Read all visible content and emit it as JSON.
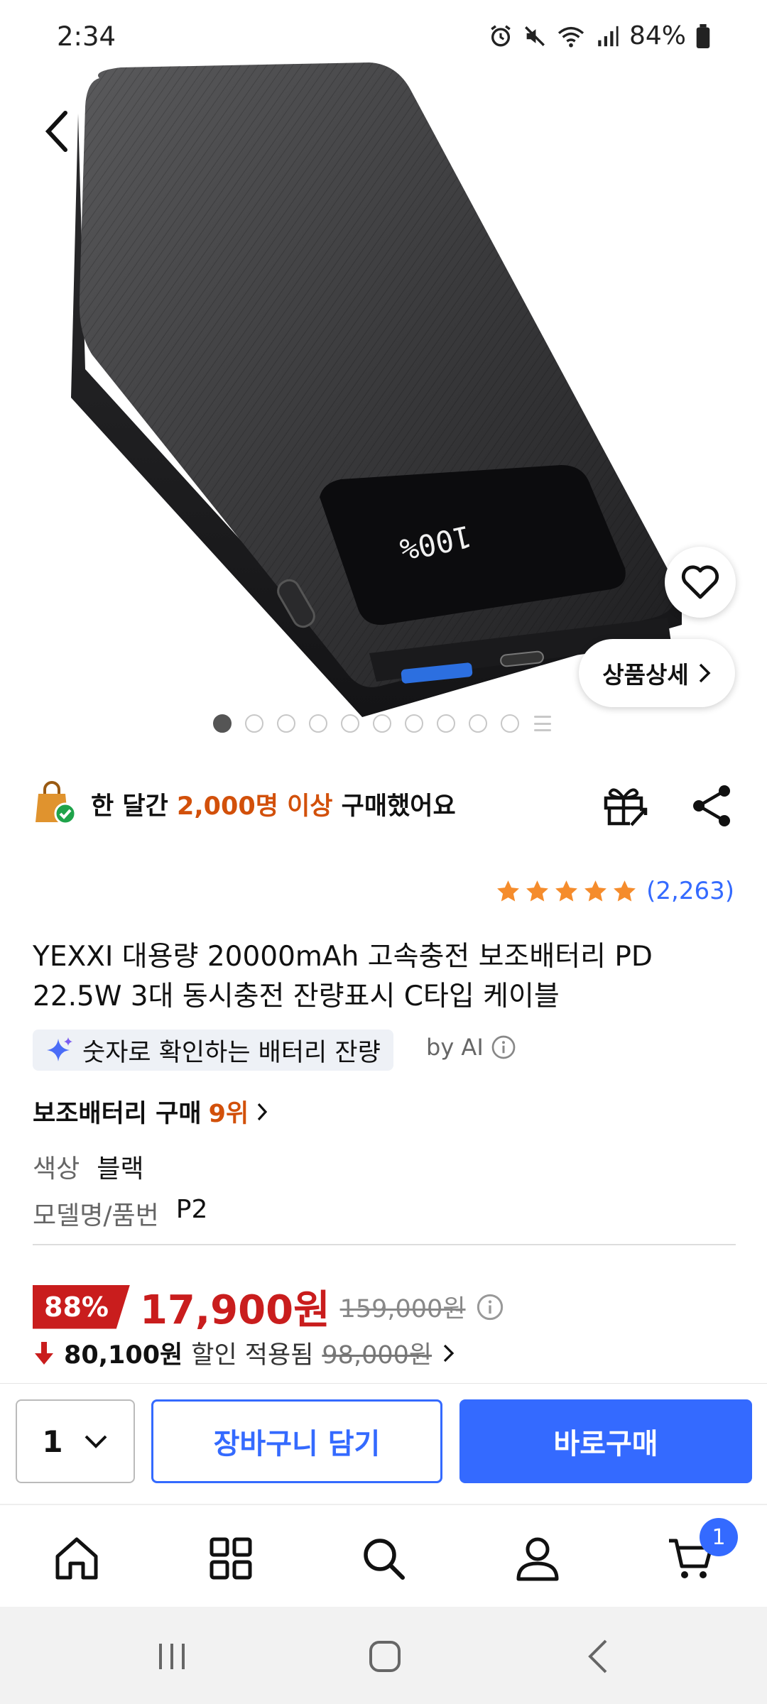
{
  "status_bar": {
    "time": "2:34",
    "battery": "84%"
  },
  "gallery": {
    "total_slides": 10,
    "active_index": 0,
    "detail_label": "상품상세"
  },
  "purchase_banner": {
    "prefix": "한 달간",
    "highlight": "2,000명 이상",
    "suffix": "구매했어요"
  },
  "rating": {
    "stars": 5,
    "count": "(2,263)"
  },
  "product": {
    "title": "YEXXI 대용량 20000mAh 고속충전 보조배터리 PD 22.5W 3대 동시충전 잔량표시 C타입 케이블",
    "ai_highlight": "숫자로 확인하는 배터리 잔량",
    "by_ai": "by AI",
    "rank_label": "보조배터리 구매",
    "rank_value": "9위",
    "specs": [
      {
        "key": "색상",
        "value": "블랙"
      },
      {
        "key": "모델명/품번",
        "value": "P2"
      }
    ]
  },
  "price": {
    "discount_rate": "88%",
    "sale_price": "17,900원",
    "original_price": "159,000원",
    "extra_discount": "80,100원",
    "extra_discount_label": "할인 적용됨",
    "extra_original": "98,000원"
  },
  "actions": {
    "quantity": "1",
    "add_to_cart": "장바구니 담기",
    "buy_now": "바로구매"
  },
  "bottom_nav": {
    "cart_count": "1",
    "items": [
      "home-icon",
      "category-icon",
      "search-icon",
      "my-page-icon",
      "cart-icon"
    ]
  },
  "colors": {
    "accent": "#346aff",
    "price_red": "#c91d1d",
    "highlight_orange": "#d2500a"
  }
}
